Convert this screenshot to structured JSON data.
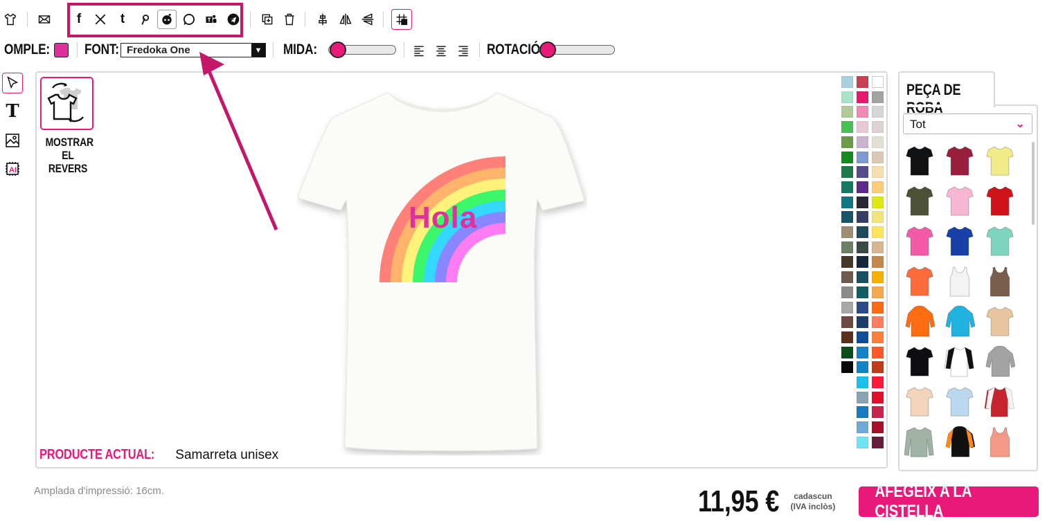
{
  "toolbar": {
    "share_icons": [
      "facebook-icon",
      "x-icon",
      "tumblr-icon",
      "pinterest-icon",
      "reddit-icon",
      "whatsapp-icon",
      "teams-icon",
      "telegram-icon"
    ]
  },
  "format_bar": {
    "fill_label": "OMPLE:",
    "fill_color": "#e0309c",
    "font_label": "FONT:",
    "font_value": "Fredoka One",
    "size_label": "MIDA:",
    "size_value": 0,
    "rotation_label": "ROTACIÓ:",
    "rotation_value": 0
  },
  "canvas": {
    "back_button_label_line1": "MOSTRAR",
    "back_button_label_line2": "EL REVERS",
    "current_product_label": "PRODUCTE ACTUAL:",
    "current_product_value": "Samarreta unisex",
    "design_text": "Hola",
    "design_text_color": "#e0309c",
    "shirt_color": "#fbfbf8"
  },
  "palette": {
    "col1": [
      "#a9cfe0",
      "#a8e2c8",
      "#b3c99a",
      "#47c154",
      "#6b9b4a",
      "#148a1f",
      "#1e7a4a",
      "#157a60",
      "#137783",
      "#1a5467",
      "#a08d75",
      "#6b8064",
      "#453828",
      "#6f5a4f",
      "#8b8b8b",
      "#a7a7a7",
      "#6e4a43",
      "#5e2f1d",
      "#0d4c1d",
      "#0a0a0a"
    ],
    "col2": [
      "#c93f54",
      "#e8196c",
      "#ef8bb3",
      "#e8c9d3",
      "#c9b3d0",
      "#7e9ad1",
      "#564e8c",
      "#5b2a8a",
      "#2a2636",
      "#383d63",
      "#1f4a59",
      "#3a4a44",
      "#17273b",
      "#1a4f63",
      "#0f5e63",
      "#2b4a8a",
      "#1a3f6b",
      "#0f4f9a",
      "#1582c9",
      "#1283c2",
      "#1ac1ea",
      "#8aa3b5",
      "#177bc0",
      "#71a9d6",
      "#6ee3f2"
    ],
    "col3": [
      "#ffffff",
      "#a3a3a3",
      "#d6d6d6",
      "#dcd3d3",
      "#e3dfd4",
      "#d9c8b4",
      "#f5dfae",
      "#ffcc7a",
      "#dde818",
      "#f0e57a",
      "#ffe45a",
      "#d6b68f",
      "#c4894a",
      "#f5b000",
      "#f6a84d",
      "#ff6b14",
      "#ff7e5f",
      "#ff7e3b",
      "#ff5a28",
      "#c23a1a",
      "#ff1a3c",
      "#e0102b",
      "#c8244d",
      "#a8102b",
      "#6a1d3a"
    ]
  },
  "panel": {
    "tab_label": "PEÇA DE ROBA",
    "category_value": "Tot"
  },
  "garments": [
    {
      "name": "black-tshirt",
      "color": "#111214",
      "type": "tee"
    },
    {
      "name": "burgundy-tshirt",
      "color": "#9a1f3d",
      "type": "tee"
    },
    {
      "name": "yellow-tshirt",
      "color": "#f3ea8a",
      "type": "tee"
    },
    {
      "name": "olive-tshirt",
      "color": "#4b5238",
      "type": "tee"
    },
    {
      "name": "pink-tshirt",
      "color": "#f7b6d2",
      "type": "tee"
    },
    {
      "name": "red-tshirt",
      "color": "#d0121a",
      "type": "tee"
    },
    {
      "name": "hotpink-tshirt",
      "color": "#f25aa8",
      "type": "tee"
    },
    {
      "name": "blue-tshirt",
      "color": "#1840a6",
      "type": "tee"
    },
    {
      "name": "mint-tshirt",
      "color": "#7fd4bf",
      "type": "tee"
    },
    {
      "name": "coral-tshirt",
      "color": "#ff6b3a",
      "type": "tee"
    },
    {
      "name": "white-tank",
      "color": "#f3f3f3",
      "type": "tank"
    },
    {
      "name": "brown-tank",
      "color": "#7a5e4c",
      "type": "tank"
    },
    {
      "name": "orange-hoodie",
      "color": "#ff6d12",
      "type": "hoodie"
    },
    {
      "name": "cyan-hoodie",
      "color": "#22b2e0",
      "type": "hoodie"
    },
    {
      "name": "tiedye-tshirt",
      "color": "#e8c6a0",
      "type": "tee"
    },
    {
      "name": "black-tshirt-2",
      "color": "#0d0d12",
      "type": "tee"
    },
    {
      "name": "raglan-shirt",
      "color": "#ffffff",
      "type": "raglan"
    },
    {
      "name": "grey-hoodie",
      "color": "#a3a3a3",
      "type": "hoodie"
    },
    {
      "name": "peach-tshirt",
      "color": "#f5d4bc",
      "type": "tee"
    },
    {
      "name": "gradient-tshirt",
      "color": "#bcd8ee",
      "type": "tee"
    },
    {
      "name": "varsity-jacket",
      "color": "#c4252f",
      "type": "jacket"
    },
    {
      "name": "sage-longsleeve",
      "color": "#9fb2a5",
      "type": "long"
    },
    {
      "name": "black-orange-hoodie",
      "color": "#111111",
      "type": "hoodie"
    },
    {
      "name": "salmon-tank",
      "color": "#f39a86",
      "type": "tank"
    }
  ],
  "footer": {
    "print_width": "Amplada d'impressió: 16cm.",
    "price": "11,95 €",
    "each_line1": "cadascun",
    "each_line2": "(IVA inclòs)",
    "cart_button": "AFEGEIX A LA CISTELLA"
  },
  "accent_color": "#e8197b",
  "annotation_color": "#c5176a"
}
